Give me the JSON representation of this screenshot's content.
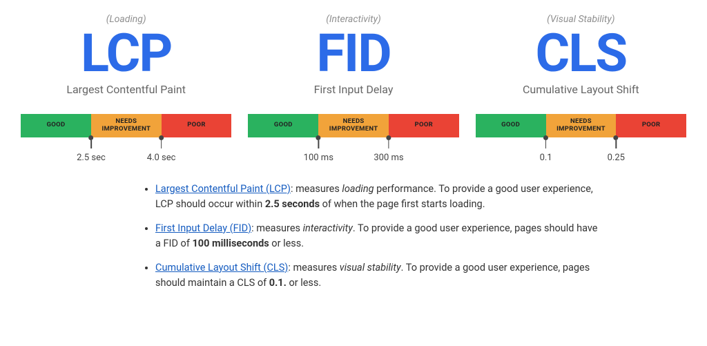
{
  "bar_labels": {
    "good": "GOOD",
    "needs": "NEEDS\nIMPROVEMENT",
    "poor": "POOR"
  },
  "metrics": [
    {
      "category": "(Loading)",
      "abbr": "LCP",
      "fullname": "Largest Contentful Paint",
      "threshold1": "2.5 sec",
      "threshold2": "4.0 sec"
    },
    {
      "category": "(Interactivity)",
      "abbr": "FID",
      "fullname": "First Input Delay",
      "threshold1": "100 ms",
      "threshold2": "300 ms"
    },
    {
      "category": "(Visual Stability)",
      "abbr": "CLS",
      "fullname": "Cumulative Layout Shift",
      "threshold1": "0.1",
      "threshold2": "0.25"
    }
  ],
  "descriptions": [
    {
      "link": "Largest Contentful Paint (LCP)",
      "text1": ": measures ",
      "em": "loading",
      "text2": " performance. To provide a good user experience, LCP should occur within ",
      "bold": "2.5 seconds",
      "text3": " of when the page first starts loading."
    },
    {
      "link": "First Input Delay (FID)",
      "text1": ": measures ",
      "em": "interactivity",
      "text2": ". To provide a good user experience, pages should have a FID of ",
      "bold": "100 milliseconds",
      "text3": " or less."
    },
    {
      "link": "Cumulative Layout Shift (CLS)",
      "text1": ": measures ",
      "em": "visual stability",
      "text2": ". To provide a good user experience, pages should maintain a CLS of ",
      "bold": "0.1.",
      "text3": " or less."
    }
  ],
  "colors": {
    "good": "#2ab25f",
    "needs": "#f1a33a",
    "poor": "#ea4335",
    "accent": "#2c6be8",
    "link": "#155cc0"
  }
}
